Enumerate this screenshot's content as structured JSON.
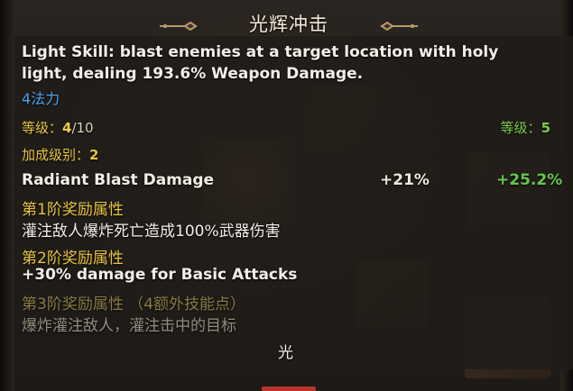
{
  "skill": {
    "title": "光辉冲击",
    "description": "Light Skill: blast enemies at a target location with holy light, dealing 193.6% Weapon Damage.",
    "cost": "4法力",
    "level_label": "等级：",
    "level_current": "4",
    "level_max": "/10",
    "required_label": "等级：",
    "required_value": "5",
    "bonus_label": "加成级别：",
    "bonus_value": "2",
    "stat": {
      "name": "Radiant Blast Damage",
      "current": "+21%",
      "next": "+25.2%"
    },
    "rewards": [
      {
        "header": "第1阶奖励属性",
        "text": "灌注敌人爆炸死亡造成100%武器伤害",
        "unlocked": true
      },
      {
        "header": "第2阶奖励属性",
        "text": "+30% damage for Basic Attacks",
        "unlocked": true
      },
      {
        "header": "第3阶奖励属性  （4额外技能点）",
        "text": "爆炸灌注敌人，灌注击中的目标",
        "unlocked": false
      }
    ],
    "element": "光"
  },
  "colors": {
    "title_text": "#f3ead8",
    "gold_label": "#e8c440",
    "mana_blue": "#4aa3f0",
    "green_value": "#64c84a",
    "locked_text": "#948d80"
  },
  "icons": [
    "title-ornament-left-icon",
    "title-ornament-right-icon"
  ]
}
